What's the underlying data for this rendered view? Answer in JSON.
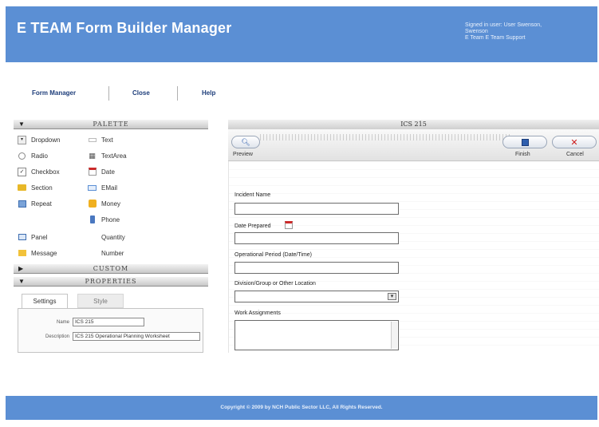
{
  "header": {
    "title": "E TEAM Form Builder Manager",
    "user_line1": "Signed in user: User Swenson,",
    "user_line2": "Swenson",
    "user_line3": "E Team E Team Support"
  },
  "nav": {
    "form_manager": "Form Manager",
    "close": "Close",
    "help": "Help"
  },
  "palette": {
    "title": "PALETTE",
    "items_left": [
      {
        "label": "Dropdown",
        "icon": "dropdown-icon"
      },
      {
        "label": "Radio",
        "icon": "radio-icon"
      },
      {
        "label": "Checkbox",
        "icon": "checkbox-icon"
      },
      {
        "label": "Section",
        "icon": "folder-icon"
      },
      {
        "label": "Repeat",
        "icon": "repeat-icon"
      },
      {
        "label": "Panel",
        "icon": "panel-icon"
      },
      {
        "label": "Message",
        "icon": "message-icon"
      }
    ],
    "items_right": [
      {
        "label": "Text",
        "icon": "text-icon"
      },
      {
        "label": "TextArea",
        "icon": "textarea-icon"
      },
      {
        "label": "Date",
        "icon": "calendar-icon"
      },
      {
        "label": "EMail",
        "icon": "email-icon"
      },
      {
        "label": "Money",
        "icon": "money-icon"
      },
      {
        "label": "Phone",
        "icon": "phone-icon"
      },
      {
        "label": "Quantity",
        "icon": ""
      },
      {
        "label": "Number",
        "icon": ""
      }
    ]
  },
  "custom": {
    "title": "CUSTOM"
  },
  "properties": {
    "title": "PROPERTIES",
    "tab_settings": "Settings",
    "tab_style": "Style",
    "name_label": "Name",
    "name_value": "ICS 215",
    "description_label": "Description",
    "description_value": "ICS 215 Operational Planning Worksheet"
  },
  "form": {
    "title": "ICS 215",
    "preview_label": "Preview",
    "finish_label": "Finish",
    "cancel_label": "Cancel",
    "fields": {
      "incident_name": "Incident Name",
      "date_prepared": "Date Prepared",
      "operational_period": "Operational Period (Date/Time)",
      "division_group": "Division/Group or Other Location",
      "work_assignments": "Work Assignments"
    }
  },
  "footer": {
    "copyright": "Copyright © 2009 by NCH Public Sector LLC, All Rights Reserved."
  },
  "colors": {
    "brand_blue": "#5b8fd4",
    "nav_link": "#1d3d7a",
    "cancel_red": "#cc1a1a",
    "finish_blue": "#2f5fae"
  }
}
